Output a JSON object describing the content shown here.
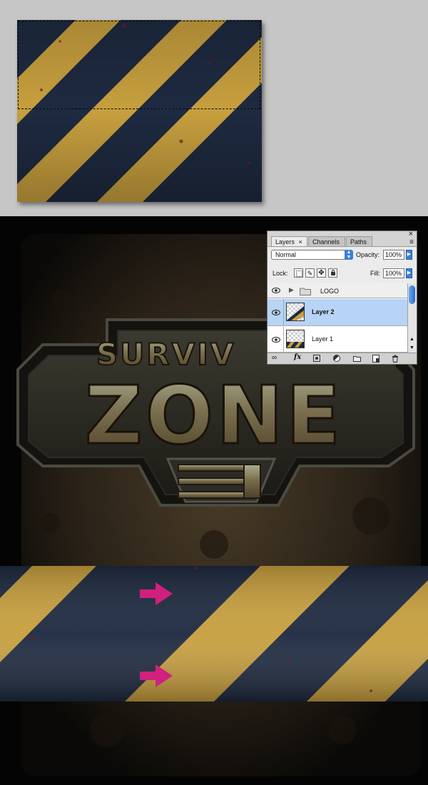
{
  "colors": {
    "hazard_yellow": "#c79f3e",
    "hazard_navy": "#1e2a40",
    "arrow_magenta": "#d2207e",
    "panel_bg": "#d4d4d4",
    "selected_row": "#b7d3f5",
    "workspace_gray": "#c6c6c6"
  },
  "logo": {
    "line1": "SURVIV",
    "line2": "ZONE"
  },
  "layers_panel": {
    "tabs": [
      "Layers",
      "Channels",
      "Paths"
    ],
    "active_tab": "Layers",
    "tab_close_glyph": "×",
    "window_close_glyph": "×",
    "panel_menu_glyph": "≡",
    "blend_mode": "Normal",
    "opacity_label": "Opacity:",
    "opacity_value": "100%",
    "lock_label": "Lock:",
    "fill_label": "Fill:",
    "fill_value": "100%",
    "layers": [
      {
        "name": "LOGO",
        "type": "group",
        "visible": true,
        "selected": false,
        "icon": "folder-icon"
      },
      {
        "name": "Layer 2",
        "type": "layer",
        "visible": true,
        "selected": true
      },
      {
        "name": "Layer 1",
        "type": "layer",
        "visible": true,
        "selected": false
      }
    ],
    "bottom_icons": [
      "link-icon",
      "fx-icon",
      "mask-icon",
      "adjustment-icon",
      "folder-icon",
      "new-layer-icon",
      "trash-icon"
    ],
    "fx_label": "fx"
  },
  "annotations": {
    "arrows": 2,
    "arrow_icon": "arrow-right-icon"
  }
}
